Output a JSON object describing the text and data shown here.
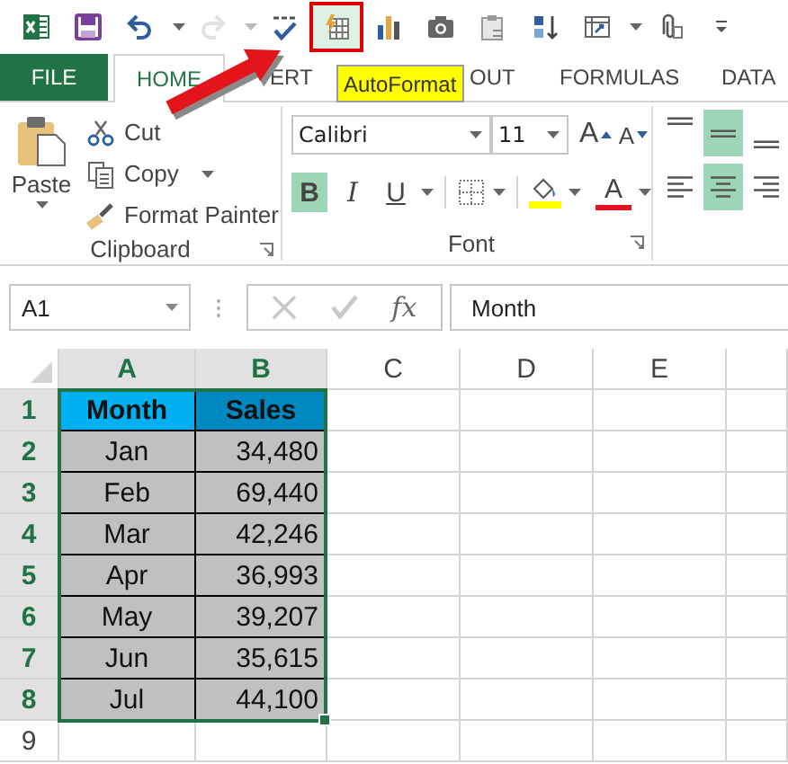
{
  "quick_access": [
    {
      "kind": "logo",
      "disabled": false,
      "highlighted": false
    },
    {
      "kind": "save",
      "disabled": false,
      "highlighted": false
    },
    {
      "kind": "undo",
      "disabled": false,
      "highlighted": false
    },
    {
      "kind": "redo",
      "disabled": true,
      "highlighted": false
    },
    {
      "kind": "spelling",
      "disabled": false,
      "highlighted": false
    },
    {
      "kind": "autoformat",
      "disabled": false,
      "highlighted": true
    },
    {
      "kind": "chart",
      "disabled": false,
      "highlighted": false
    },
    {
      "kind": "camera",
      "disabled": false,
      "highlighted": false
    },
    {
      "kind": "paste-values",
      "disabled": false,
      "highlighted": false
    },
    {
      "kind": "sort",
      "disabled": false,
      "highlighted": false
    },
    {
      "kind": "form",
      "disabled": false,
      "highlighted": false
    },
    {
      "kind": "attach",
      "disabled": false,
      "highlighted": false
    },
    {
      "kind": "more",
      "disabled": false,
      "highlighted": false
    }
  ],
  "tooltip": {
    "text": "AutoFormat"
  },
  "tabs": [
    {
      "kind": "file",
      "label": "FILE",
      "selected": false
    },
    {
      "kind": "tab",
      "label": "HOME",
      "selected": true
    },
    {
      "kind": "tab",
      "label": "ERT",
      "selected": false
    },
    {
      "kind": "tab",
      "label": "OUT",
      "selected": false
    },
    {
      "kind": "tab",
      "label": "FORMULAS",
      "selected": false
    },
    {
      "kind": "tab",
      "label": "DATA",
      "selected": false
    }
  ],
  "clipboard": {
    "paste_label": "Paste",
    "commands": [
      {
        "kind": "cut",
        "label": "Cut"
      },
      {
        "kind": "copy",
        "label": "Copy"
      },
      {
        "kind": "format-painter",
        "label": "Format Painter"
      }
    ],
    "group_label": "Clipboard"
  },
  "font": {
    "font_name": "Calibri",
    "font_size": "11",
    "grow_glyph": "A",
    "shrink_glyph": "A",
    "styles": [
      {
        "kind": "bold",
        "label": "B",
        "selected": true
      },
      {
        "kind": "italic",
        "label": "I",
        "selected": false
      },
      {
        "kind": "underline",
        "label": "U",
        "selected": false
      }
    ],
    "font_color_glyph": "A",
    "group_label": "Font"
  },
  "alignment": [
    {
      "kind": "top",
      "selected": false
    },
    {
      "kind": "middle",
      "selected": true
    },
    {
      "kind": "bottom",
      "selected": false
    },
    {
      "kind": "left",
      "selected": false
    },
    {
      "kind": "center",
      "selected": true
    },
    {
      "kind": "right",
      "selected": false
    }
  ],
  "formula_bar": {
    "name_box": "A1",
    "function_label": "fx",
    "formula": "Month"
  },
  "sheet": {
    "columns": [
      {
        "label": "A",
        "selected": true
      },
      {
        "label": "B",
        "selected": true
      },
      {
        "label": "C",
        "selected": false
      },
      {
        "label": "D",
        "selected": false
      },
      {
        "label": "E",
        "selected": false
      }
    ],
    "rows": [
      {
        "number": "1",
        "selected": true,
        "kind": "header",
        "cells": [
          "Month",
          "Sales"
        ]
      },
      {
        "number": "2",
        "selected": true,
        "kind": "data",
        "cells": [
          "Jan",
          "34,480"
        ]
      },
      {
        "number": "3",
        "selected": true,
        "kind": "data",
        "cells": [
          "Feb",
          "69,440"
        ]
      },
      {
        "number": "4",
        "selected": true,
        "kind": "data",
        "cells": [
          "Mar",
          "42,246"
        ]
      },
      {
        "number": "5",
        "selected": true,
        "kind": "data",
        "cells": [
          "Apr",
          "36,993"
        ]
      },
      {
        "number": "6",
        "selected": true,
        "kind": "data",
        "cells": [
          "May",
          "39,207"
        ]
      },
      {
        "number": "7",
        "selected": true,
        "kind": "data",
        "cells": [
          "Jun",
          "35,615"
        ]
      },
      {
        "number": "8",
        "selected": true,
        "kind": "data",
        "cells": [
          "Jul",
          "44,100"
        ]
      },
      {
        "number": "9",
        "selected": false,
        "kind": "empty"
      }
    ]
  }
}
